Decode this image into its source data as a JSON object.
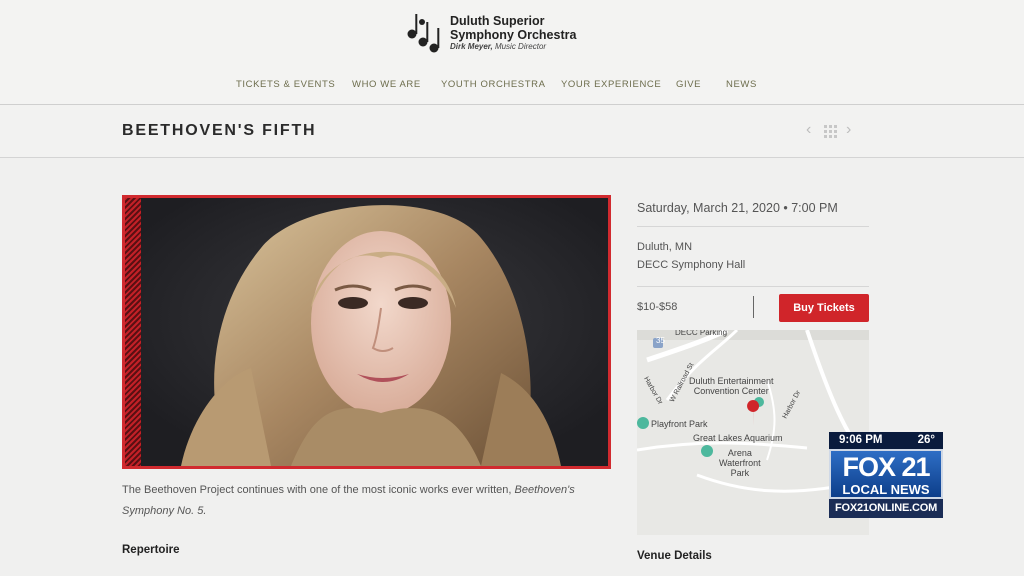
{
  "header": {
    "org_name_line1": "Duluth Superior",
    "org_name_line2": "Symphony Orchestra",
    "director_name": "Dirk Meyer,",
    "director_title": "Music Director"
  },
  "nav": {
    "items": [
      "TICKETS & EVENTS",
      "WHO WE ARE",
      "YOUTH ORCHESTRA",
      "YOUR EXPERIENCE",
      "GIVE",
      "NEWS"
    ]
  },
  "page": {
    "title": "BEETHOVEN'S FIFTH"
  },
  "hero": {
    "description_main": "The Beethoven Project continues with one of the most iconic works ever written, ",
    "description_italic": "Beethoven's Symphony No. 5."
  },
  "sections": {
    "repertoire": "Repertoire",
    "venue_details": "Venue Details"
  },
  "event": {
    "date_time": "Saturday, March 21, 2020 • 7:00 PM",
    "city": "Duluth, MN",
    "venue": "DECC Symphony Hall",
    "price": "$10-$58",
    "buy_label": "Buy Tickets"
  },
  "map": {
    "labels": {
      "decc": "Duluth Entertainment\nConvention Center",
      "playfront": "Playfront Park",
      "aquarium": "Great Lakes Aquarium",
      "arena": "Arena\nWaterfront\nPark",
      "railroad": "W Railroad St",
      "harbor_dr": "Harbor Dr",
      "harbor_dr_2": "Harbor Dr",
      "route": "35",
      "top_partial": "DECC Parking"
    }
  },
  "overlay": {
    "time": "9:06 PM",
    "temp": "26°",
    "brand": "FOX 21",
    "sub": "LOCAL NEWS",
    "url": "FOX21ONLINE.COM"
  },
  "colors": {
    "accent_red": "#d0252a",
    "nav_text": "#6d6d4d",
    "fox_blue": "#0d3e8a"
  }
}
